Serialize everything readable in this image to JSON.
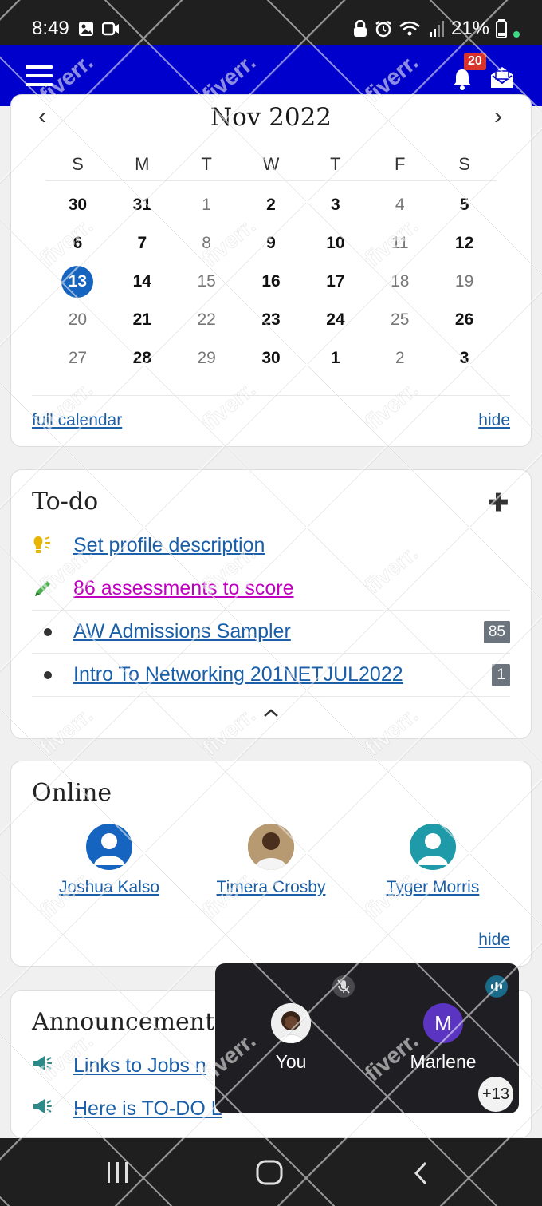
{
  "status_bar": {
    "time": "8:49",
    "battery": "21%"
  },
  "header": {
    "notification_count": "20"
  },
  "calendar": {
    "month_title": "Nov 2022",
    "weekdays": [
      "S",
      "M",
      "T",
      "W",
      "T",
      "F",
      "S"
    ],
    "weeks": [
      [
        "30",
        "31",
        "1",
        "2",
        "3",
        "4",
        "5"
      ],
      [
        "6",
        "7",
        "8",
        "9",
        "10",
        "11",
        "12"
      ],
      [
        "13",
        "14",
        "15",
        "16",
        "17",
        "18",
        "19"
      ],
      [
        "20",
        "21",
        "22",
        "23",
        "24",
        "25",
        "26"
      ],
      [
        "27",
        "28",
        "29",
        "30",
        "1",
        "2",
        "3"
      ]
    ],
    "today": "13",
    "full_calendar_link": "full calendar",
    "hide_link": "hide"
  },
  "todo": {
    "title": "To-do",
    "items": [
      {
        "label": "Set profile description",
        "icon": "lightbulb-icon"
      },
      {
        "label": "86 assessments to score",
        "icon": "pencil-icon",
        "color": "#c000c0"
      },
      {
        "label": "AW Admissions Sampler",
        "count": "85"
      },
      {
        "label": "Intro To Networking 201NETJUL2022",
        "count": "1"
      }
    ]
  },
  "online": {
    "title": "Online",
    "users": [
      {
        "name": "Joshua Kalso",
        "avatar": "default-avatar-blue"
      },
      {
        "name": "Timera Crosby",
        "avatar": "photo"
      },
      {
        "name": "Tyger Morris",
        "avatar": "default-avatar-teal"
      }
    ],
    "hide_link": "hide"
  },
  "announcements": {
    "title": "Announcements",
    "items": [
      {
        "label": "Links to Jobs n"
      },
      {
        "label": "Here is TO-DO L"
      }
    ]
  },
  "call": {
    "participants": [
      {
        "name": "You"
      },
      {
        "name": "Marlene",
        "initial": "M"
      }
    ],
    "more_count": "+13"
  },
  "colors": {
    "header_bg": "#0000cc",
    "today_bg": "#1565c0",
    "link": "#1a5fa8",
    "badge": "#d9342b"
  },
  "watermark": "fiverr."
}
